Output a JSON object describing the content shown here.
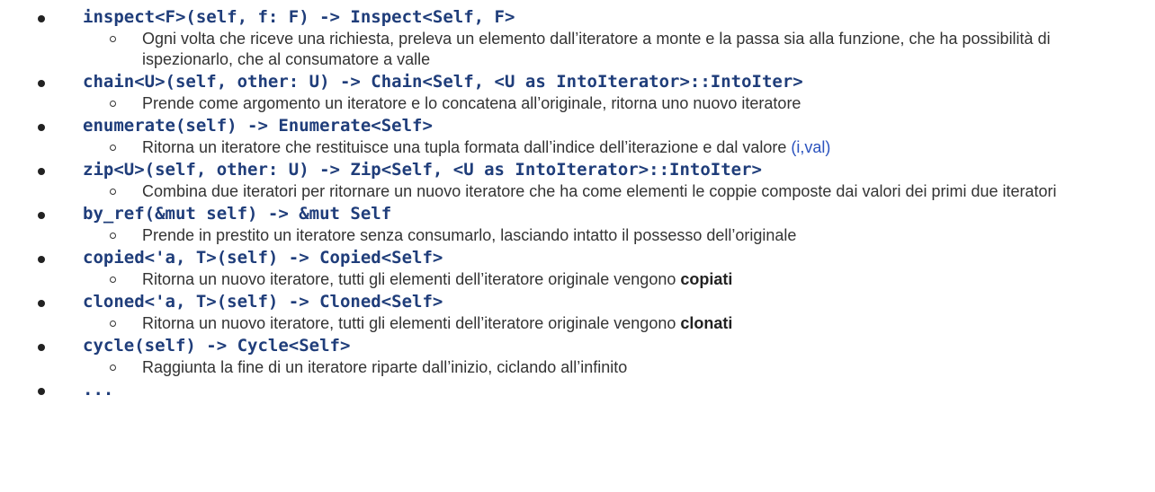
{
  "items": [
    {
      "code": "inspect<F>(self, f: F) -> Inspect<Self, F>",
      "desc": "Ogni volta che riceve una richiesta, preleva un elemento dall’iteratore a monte e la passa sia alla funzione, che ha possibilità di ispezionarlo, che al consumatore a valle"
    },
    {
      "code": "chain<U>(self, other: U) -> Chain<Self, <U as IntoIterator>::IntoIter>",
      "desc": "Prende come argomento un iteratore e lo concatena all’originale, ritorna uno nuovo iteratore"
    },
    {
      "code": "enumerate(self) -> Enumerate<Self>",
      "desc": "Ritorna un iteratore che restituisce una tupla formata dall’indice dell’iterazione e dal valore ",
      "desc_highlight": "(i,val)"
    },
    {
      "code": "zip<U>(self, other: U) -> Zip<Self, <U as IntoIterator>::IntoIter>",
      "desc": "Combina due iteratori per ritornare un nuovo iteratore che ha come elementi le coppie composte dai valori dei primi due iteratori"
    },
    {
      "code": "by_ref(&mut self) -> &mut Self",
      "desc": "Prende in prestito un iteratore senza consumarlo, lasciando intatto il possesso dell’originale"
    },
    {
      "code": "copied<'a, T>(self) -> Copied<Self>",
      "desc": "Ritorna un nuovo iteratore, tutti gli elementi dell’iteratore originale vengono ",
      "desc_bold": "copiati"
    },
    {
      "code": "cloned<'a, T>(self) -> Cloned<Self>",
      "desc": "Ritorna un nuovo iteratore, tutti gli elementi dell’iteratore originale vengono ",
      "desc_bold": "clonati"
    },
    {
      "code": "cycle(self) -> Cycle<Self>",
      "desc": "Raggiunta la fine di un iteratore riparte dall’inizio, ciclando all’infinito"
    },
    {
      "code": "..."
    }
  ]
}
